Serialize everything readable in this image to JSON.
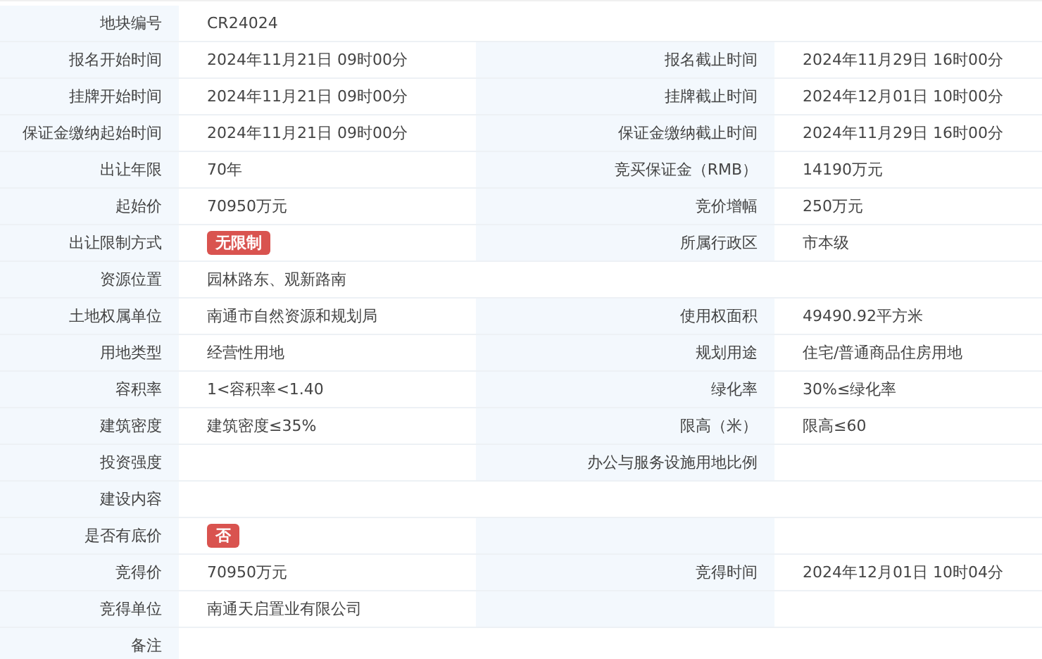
{
  "rows": [
    {
      "label": "地块编号",
      "value": "CR24024",
      "kind": "full"
    },
    {
      "label": "报名开始时间",
      "value": "2024年11月21日 09时00分",
      "label2": "报名截止时间",
      "value2": "2024年11月29日 16时00分",
      "kind": "pair"
    },
    {
      "label": "挂牌开始时间",
      "value": "2024年11月21日 09时00分",
      "label2": "挂牌截止时间",
      "value2": "2024年12月01日 10时00分",
      "kind": "pair"
    },
    {
      "label": "保证金缴纳起始时间",
      "value": "2024年11月21日 09时00分",
      "label2": "保证金缴纳截止时间",
      "value2": "2024年11月29日 16时00分",
      "kind": "pair"
    },
    {
      "label": "出让年限",
      "value": "70年",
      "label2": "竞买保证金（RMB）",
      "value2": "14190万元",
      "kind": "pair"
    },
    {
      "label": "起始价",
      "value": "70950万元",
      "label2": "竞价增幅",
      "value2": "250万元",
      "kind": "pair"
    },
    {
      "label": "出让限制方式",
      "badge": "无限制",
      "label2": "所属行政区",
      "value2": "市本级",
      "kind": "pair"
    },
    {
      "label": "资源位置",
      "value": "园林路东、观新路南",
      "kind": "full"
    },
    {
      "label": "土地权属单位",
      "value": "南通市自然资源和规划局",
      "label2": "使用权面积",
      "value2": "49490.92平方米",
      "kind": "pair"
    },
    {
      "label": "用地类型",
      "value": "经营性用地",
      "label2": "规划用途",
      "value2": "住宅/普通商品住房用地",
      "kind": "pair"
    },
    {
      "label": "容积率",
      "value": "1<容积率<1.40",
      "label2": "绿化率",
      "value2": "30%≤绿化率",
      "kind": "pair"
    },
    {
      "label": "建筑密度",
      "value": "建筑密度≤35%",
      "label2": "限高（米）",
      "value2": "限高≤60",
      "kind": "pair"
    },
    {
      "label": "投资强度",
      "label2": "办公与服务设施用地比例",
      "kind": "pair"
    },
    {
      "label": "建设内容",
      "kind": "full"
    },
    {
      "label": "是否有底价",
      "badge": "否",
      "kind": "pair"
    },
    {
      "label": "竞得价",
      "value": "70950万元",
      "label2": "竞得时间",
      "value2": "2024年12月01日 10时04分",
      "kind": "pair"
    },
    {
      "label": "竞得单位",
      "value": "南通天启置业有限公司",
      "kind": "pair"
    },
    {
      "label": "备注",
      "kind": "full"
    }
  ]
}
